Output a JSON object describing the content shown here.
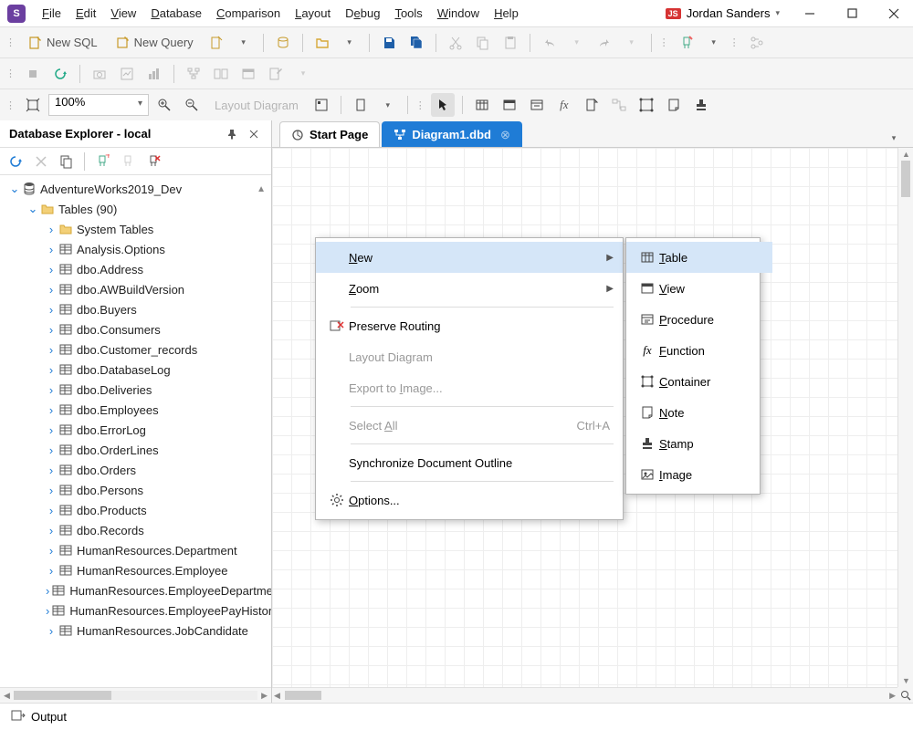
{
  "menu": [
    "File",
    "Edit",
    "View",
    "Database",
    "Comparison",
    "Layout",
    "Debug",
    "Tools",
    "Window",
    "Help"
  ],
  "user": "Jordan Sanders",
  "toolbar1": {
    "newSql": "New SQL",
    "newQuery": "New Query"
  },
  "toolbar3": {
    "zoom": "100%",
    "layoutDiagram": "Layout Diagram"
  },
  "sidebar": {
    "title": "Database Explorer - local",
    "root": "AdventureWorks2019_Dev",
    "tablesNode": "Tables (90)",
    "systemTables": "System Tables",
    "tables": [
      "Analysis.Options",
      "dbo.Address",
      "dbo.AWBuildVersion",
      "dbo.Buyers",
      "dbo.Consumers",
      "dbo.Customer_records",
      "dbo.DatabaseLog",
      "dbo.Deliveries",
      "dbo.Employees",
      "dbo.ErrorLog",
      "dbo.OrderLines",
      "dbo.Orders",
      "dbo.Persons",
      "dbo.Products",
      "dbo.Records",
      "HumanResources.Department",
      "HumanResources.Employee",
      "HumanResources.EmployeeDepartmentHistory",
      "HumanResources.EmployeePayHistory",
      "HumanResources.JobCandidate"
    ]
  },
  "tabs": {
    "start": "Start Page",
    "diagram": "Diagram1.dbd"
  },
  "contextMenu": {
    "new": "New",
    "zoom": "Zoom",
    "preserve": "Preserve Routing",
    "layout": "Layout Diagram",
    "export": "Export to Image...",
    "selectAll": "Select All",
    "selectAllHint": "Ctrl+A",
    "sync": "Synchronize Document Outline",
    "options": "Options..."
  },
  "submenu": {
    "table": "Table",
    "view": "View",
    "procedure": "Procedure",
    "function": "Function",
    "container": "Container",
    "note": "Note",
    "stamp": "Stamp",
    "image": "Image"
  },
  "status": {
    "output": "Output"
  }
}
